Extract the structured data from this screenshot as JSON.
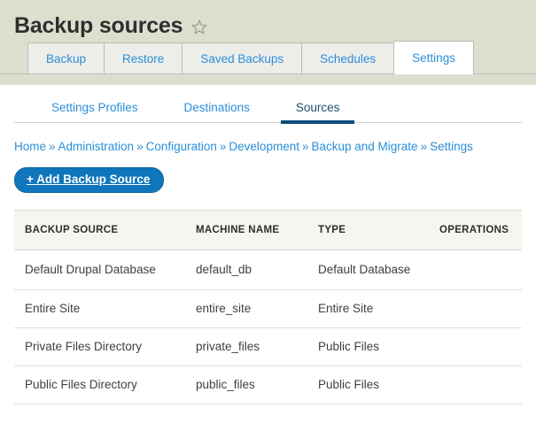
{
  "header": {
    "title": "Backup sources",
    "star_icon": "star-outline-icon"
  },
  "primary_tabs": [
    {
      "label": "Backup",
      "active": false
    },
    {
      "label": "Restore",
      "active": false
    },
    {
      "label": "Saved Backups",
      "active": false
    },
    {
      "label": "Schedules",
      "active": false
    },
    {
      "label": "Settings",
      "active": true
    }
  ],
  "secondary_tabs": [
    {
      "label": "Settings Profiles",
      "active": false
    },
    {
      "label": "Destinations",
      "active": false
    },
    {
      "label": "Sources",
      "active": true
    }
  ],
  "breadcrumb": {
    "separator": "»",
    "items": [
      "Home",
      "Administration",
      "Configuration",
      "Development",
      "Backup and Migrate",
      "Settings"
    ]
  },
  "actions": {
    "add_source_label": "+ Add Backup Source"
  },
  "table": {
    "columns": [
      "BACKUP SOURCE",
      "MACHINE NAME",
      "TYPE",
      "OPERATIONS"
    ],
    "rows": [
      {
        "name": "Default Drupal Database",
        "machine_name": "default_db",
        "type": "Default Database",
        "operations": ""
      },
      {
        "name": "Entire Site",
        "machine_name": "entire_site",
        "type": "Entire Site",
        "operations": ""
      },
      {
        "name": "Private Files Directory",
        "machine_name": "private_files",
        "type": "Public Files",
        "operations": ""
      },
      {
        "name": "Public Files Directory",
        "machine_name": "public_files",
        "type": "Public Files",
        "operations": ""
      }
    ]
  },
  "colors": {
    "header_bg": "#dedecf",
    "link": "#2b8fd9",
    "button": "#1076bc",
    "active_tab_underline": "#0b4d78",
    "table_header_bg": "#f6f6f1"
  }
}
